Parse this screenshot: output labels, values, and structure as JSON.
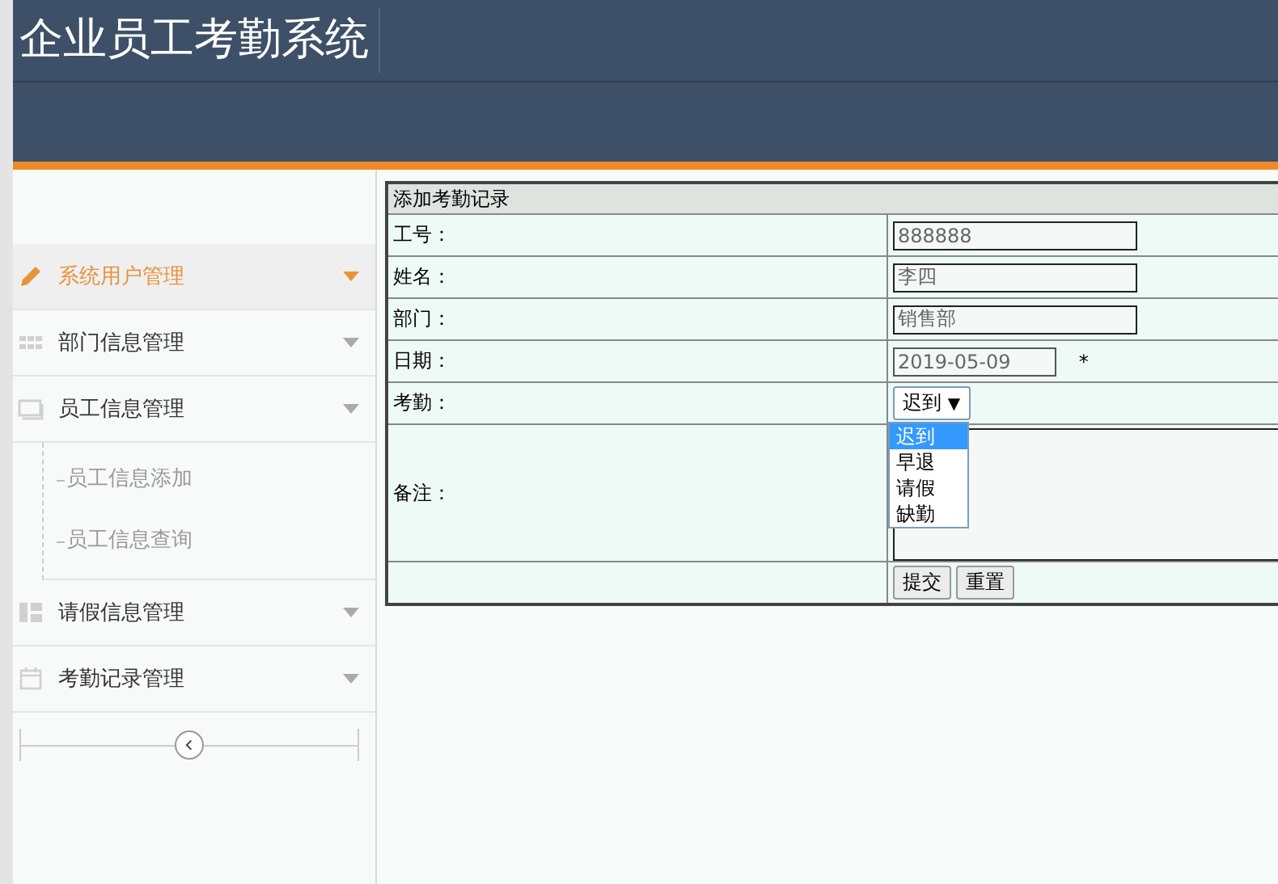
{
  "header": {
    "title": "企业员工考勤系统"
  },
  "sidebar": {
    "items": [
      {
        "label": "系统用户管理",
        "selected": true
      },
      {
        "label": "部门信息管理",
        "selected": false
      },
      {
        "label": "员工信息管理",
        "selected": false,
        "children": [
          {
            "label": "员工信息添加"
          },
          {
            "label": "员工信息查询"
          }
        ]
      },
      {
        "label": "请假信息管理",
        "selected": false
      },
      {
        "label": "考勤记录管理",
        "selected": false
      }
    ]
  },
  "form": {
    "title": "添加考勤记录",
    "fields": [
      {
        "kind": "input",
        "label": "工号：",
        "value": "888888"
      },
      {
        "kind": "input",
        "label": "姓名：",
        "value": "李四"
      },
      {
        "kind": "input",
        "label": "部门：",
        "value": "销售部"
      },
      {
        "kind": "date",
        "label": "日期：",
        "value": "2019-05-09",
        "required_mark": "*"
      },
      {
        "kind": "select",
        "label": "考勤：",
        "value": "迟到",
        "arrow": "▼",
        "options": [
          {
            "label": "迟到",
            "selected": true
          },
          {
            "label": "早退",
            "selected": false
          },
          {
            "label": "请假",
            "selected": false
          },
          {
            "label": "缺勤",
            "selected": false
          }
        ]
      },
      {
        "kind": "textarea",
        "label": "备注："
      }
    ],
    "buttons": [
      "提交",
      "重置"
    ]
  }
}
